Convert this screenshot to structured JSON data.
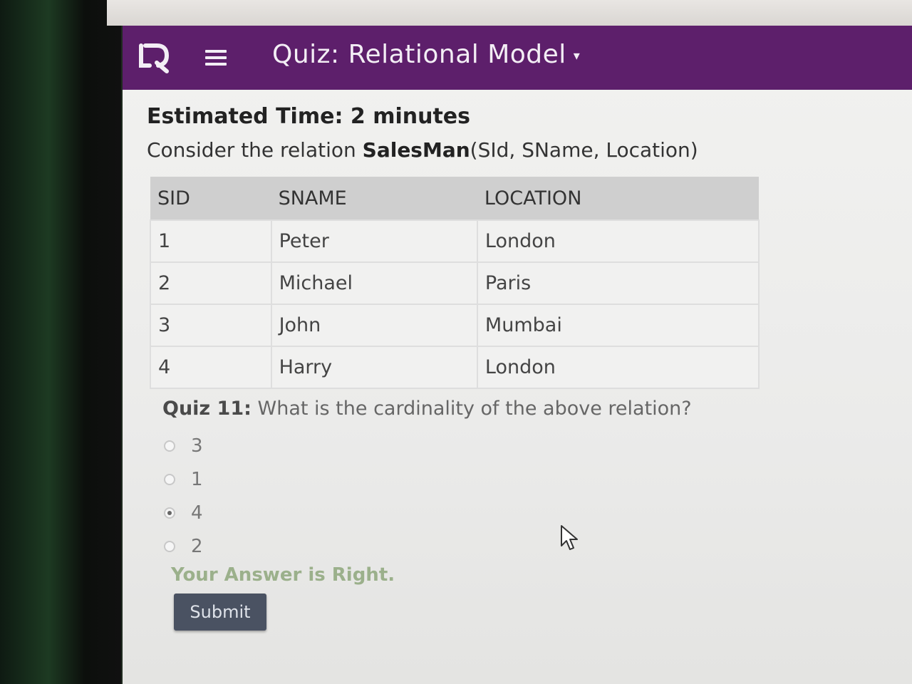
{
  "header": {
    "title": "Quiz: Relational Model",
    "caret": "▾",
    "brand_color": "#5d1f6b",
    "logo_icon": "logo-icon",
    "menu_icon": "hamburger-menu-icon"
  },
  "content": {
    "estimated_time": "Estimated Time: 2 minutes",
    "consider_prefix": "Consider the relation ",
    "relation_name": "SalesMan",
    "relation_attrs": "(SId, SName, Location)"
  },
  "table": {
    "headers": [
      "SID",
      "SNAME",
      "LOCATION"
    ],
    "rows": [
      [
        "1",
        "Peter",
        "London"
      ],
      [
        "2",
        "Michael",
        "Paris"
      ],
      [
        "3",
        "John",
        "Mumbai"
      ],
      [
        "4",
        "Harry",
        "London"
      ]
    ]
  },
  "quiz": {
    "label": "Quiz 11:",
    "question": " What is the cardinality of the above relation?",
    "options": [
      "3",
      "1",
      "4",
      "2"
    ],
    "selected": "4",
    "feedback": "Your Answer is Right.",
    "submit_label": "Submit"
  }
}
